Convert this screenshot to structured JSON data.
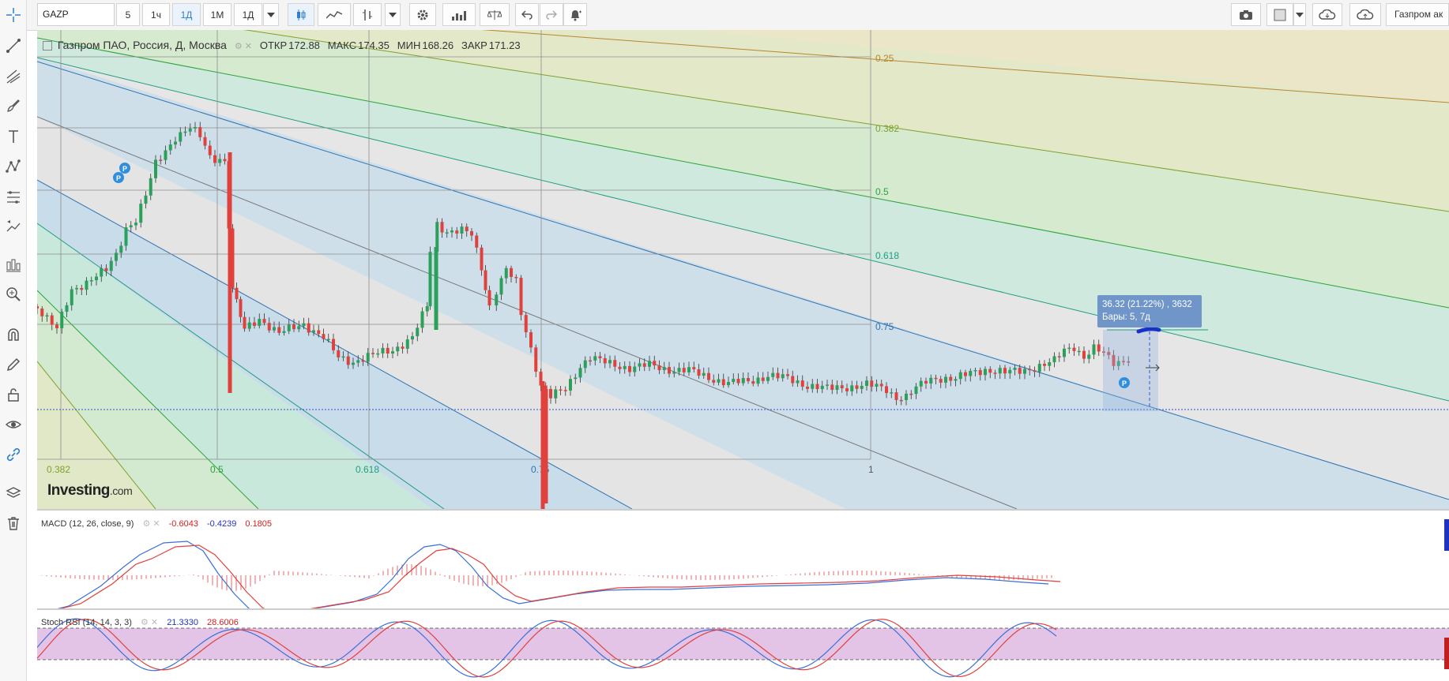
{
  "toolbar": {
    "symbol": "GAZP",
    "intervals": [
      "5",
      "1ч",
      "1Д",
      "1М",
      "1Д"
    ],
    "active_interval": "1Д",
    "right_label": "Газпром ак"
  },
  "legend": {
    "instrument": "Газпром ПАО, Россия, Д, Москва",
    "open_label": "ОТКР",
    "open": "172.88",
    "high_label": "МАКС",
    "high": "174.35",
    "low_label": "МИН",
    "low": "168.26",
    "close_label": "ЗАКР",
    "close": "171.23"
  },
  "fib_fan_labels": {
    "horizontal": [
      "0.25",
      "0.382",
      "0.5",
      "0.618",
      "0.75"
    ],
    "bottom": [
      "0.382",
      "0.5",
      "0.618",
      "0.75",
      "1"
    ]
  },
  "measure_tooltip": {
    "line1": "36.32 (21.22%) , 3632",
    "line2": "Бары: 5, 7д"
  },
  "macd": {
    "label": "MACD (12, 26, close, 9)",
    "v1": "-0.6043",
    "v2": "-0.4239",
    "v3": "0.1805"
  },
  "stoch": {
    "label": "Stoch RSI (14, 14, 3, 3)",
    "k": "21.3330",
    "d": "28.6006"
  },
  "logo": {
    "name": "Investing",
    "suffix": ".com"
  },
  "colors": {
    "candle_up": "#2aa05a",
    "candle_down": "#e0413d",
    "macd_line": "#3a6fd8",
    "signal_line": "#e0413d",
    "stoch_band": "#e3c4e6"
  }
}
